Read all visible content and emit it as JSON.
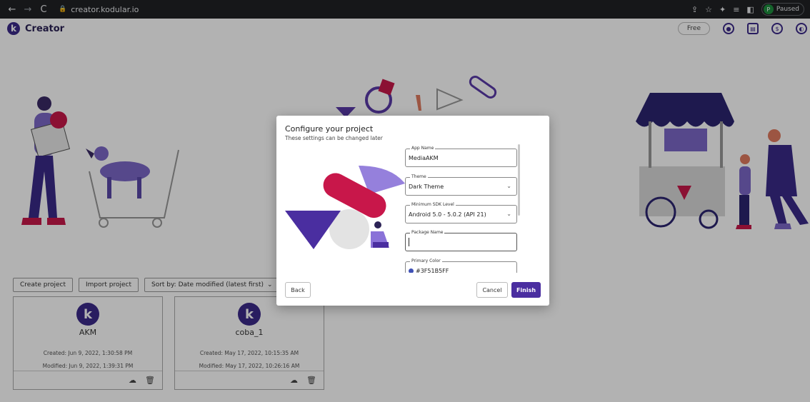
{
  "browser": {
    "url": "creator.kodular.io",
    "profile_initial": "P",
    "profile_status": "Paused"
  },
  "header": {
    "logo_letter": "k",
    "brand": "Creator",
    "plan_label": "Free"
  },
  "toolbar": {
    "create_label": "Create project",
    "import_label": "Import project",
    "sort_label": "Sort by: Date modified (latest first)"
  },
  "projects": [
    {
      "logo": "k",
      "name": "AKM",
      "created": "Created: Jun 9, 2022, 1:30:58 PM",
      "modified": "Modified: Jun 9, 2022, 1:39:31 PM"
    },
    {
      "logo": "k",
      "name": "coba_1",
      "created": "Created: May 17, 2022, 10:15:35 AM",
      "modified": "Modified: May 17, 2022, 10:26:16 AM"
    }
  ],
  "dialog": {
    "title": "Configure your project",
    "subtitle": "These settings can be changed later",
    "fields": {
      "app_name_label": "App Name",
      "app_name_value": "MediaAKM",
      "theme_label": "Theme",
      "theme_value": "Dark Theme",
      "sdk_label": "Minimum SDK Level",
      "sdk_value": "Android 5.0 - 5.0.2 (API 21)",
      "package_label": "Package Name",
      "package_value": "",
      "primary_color_label": "Primary Color",
      "primary_color_value": "#3F51B5FF"
    },
    "back_label": "Back",
    "cancel_label": "Cancel",
    "finish_label": "Finish"
  },
  "colors": {
    "brand": "#3c2a8a",
    "accent": "#4a2ea0",
    "illustration_red": "#c8174a",
    "illustration_purple": "#8a72d8"
  }
}
